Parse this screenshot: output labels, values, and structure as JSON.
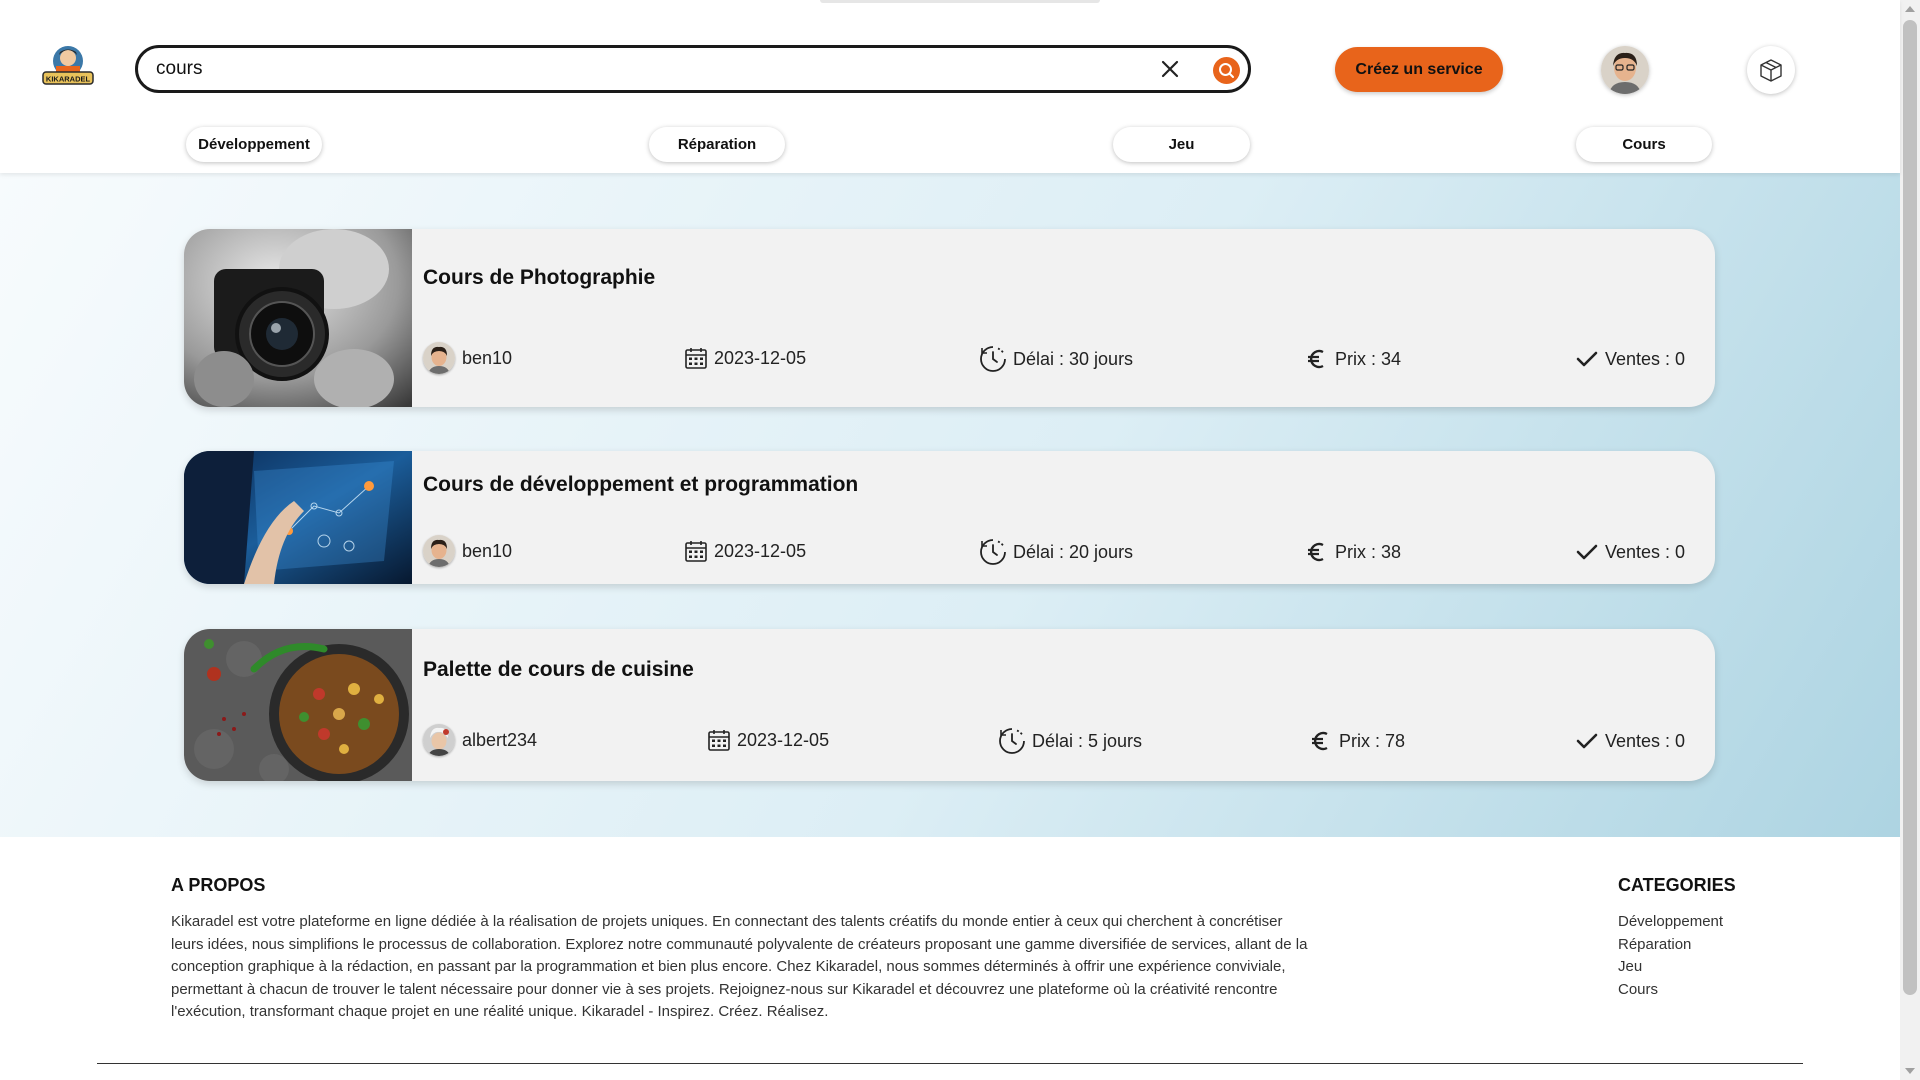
{
  "app": {
    "logo_text": "KIKARADEL"
  },
  "search": {
    "value": "cours",
    "placeholder": ""
  },
  "header": {
    "create_service_label": "Créez un service"
  },
  "categories_nav": [
    "Développement",
    "Réparation",
    "Jeu",
    "Cours"
  ],
  "services": [
    {
      "title": "Cours de Photographie",
      "seller": "ben10",
      "date": "2023-12-05",
      "delay": "Délai : 30 jours",
      "price": "Prix : 34",
      "sales": "Ventes : 0"
    },
    {
      "title": "Cours de développement et programmation",
      "seller": "ben10",
      "date": "2023-12-05",
      "delay": "Délai : 20 jours",
      "price": "Prix : 38",
      "sales": "Ventes : 0"
    },
    {
      "title": "Palette de cours de cuisine",
      "seller": "albert234",
      "date": "2023-12-05",
      "delay": "Délai : 5 jours",
      "price": "Prix : 78",
      "sales": "Ventes : 0"
    }
  ],
  "footer": {
    "about_title": "A PROPOS",
    "about_text": "Kikaradel est votre plateforme en ligne dédiée à la réalisation de projets uniques. En connectant des talents créatifs du monde entier à ceux qui cherchent à concrétiser leurs idées, nous simplifions le processus de collaboration. Explorez notre communauté polyvalente de créateurs proposant une gamme diversifiée de services, allant de la conception graphique à la rédaction, en passant par la programmation et bien plus encore. Chez Kikaradel, nous sommes déterminés à offrir une expérience conviviale, permettant à chacun de trouver le talent nécessaire pour donner vie à ses projets. Rejoignez-nous sur Kikaradel et découvrez une plateforme où la créativité rencontre l'exécution, transformant chaque projet en une réalité unique. Kikaradel - Inspirez. Créez. Réalisez.",
    "categories_title": "CATEGORIES",
    "categories": [
      "Développement",
      "Réparation",
      "Jeu",
      "Cours"
    ]
  },
  "colors": {
    "accent": "#e8641b",
    "card_bg": "#f2f2f2",
    "gradient_end": "#add4e2"
  },
  "icons": [
    "logo",
    "close-icon",
    "search-icon",
    "user-avatar",
    "box-icon",
    "calendar-icon",
    "clock-icon",
    "euro-icon",
    "check-icon"
  ]
}
